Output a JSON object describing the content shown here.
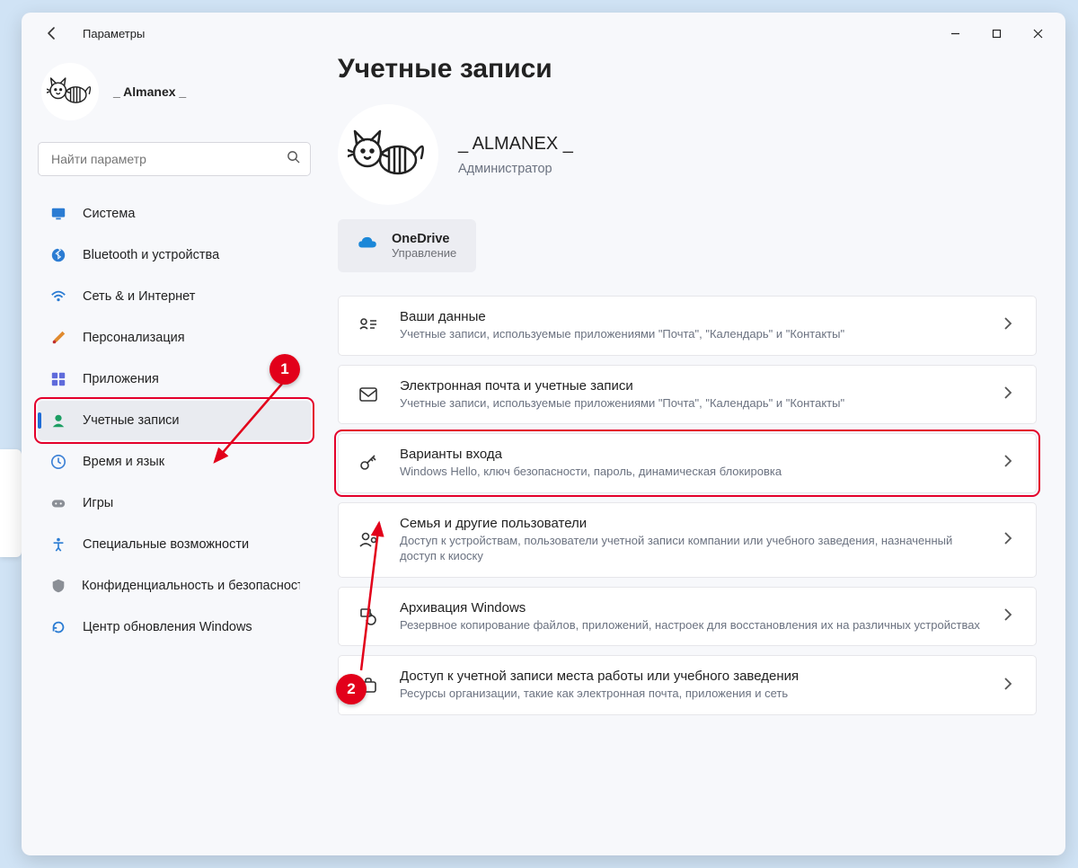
{
  "window": {
    "title": "Параметры"
  },
  "sidebar": {
    "profile_name": "_ Almanex _",
    "search_placeholder": "Найти параметр",
    "items": [
      {
        "id": "system",
        "label": "Система"
      },
      {
        "id": "bluetooth",
        "label": "Bluetooth и устройства"
      },
      {
        "id": "network",
        "label": "Сеть & и Интернет"
      },
      {
        "id": "personalization",
        "label": "Персонализация"
      },
      {
        "id": "apps",
        "label": "Приложения"
      },
      {
        "id": "accounts",
        "label": "Учетные записи"
      },
      {
        "id": "time",
        "label": "Время и язык"
      },
      {
        "id": "gaming",
        "label": "Игры"
      },
      {
        "id": "accessibility",
        "label": "Специальные возможности"
      },
      {
        "id": "privacy",
        "label": "Конфиденциальность и безопасность"
      },
      {
        "id": "update",
        "label": "Центр обновления Windows"
      }
    ]
  },
  "main": {
    "title": "Учетные записи",
    "profile_name": "_ ALMANEX _",
    "profile_role": "Администратор",
    "onedrive": {
      "title": "OneDrive",
      "sub": "Управление"
    },
    "cards": [
      {
        "id": "your-info",
        "title": "Ваши данные",
        "sub": "Учетные записи, используемые приложениями \"Почта\", \"Календарь\" и \"Контакты\""
      },
      {
        "id": "email",
        "title": "Электронная почта и учетные записи",
        "sub": "Учетные записи, используемые приложениями \"Почта\", \"Календарь\" и \"Контакты\""
      },
      {
        "id": "signin",
        "title": "Варианты входа",
        "sub": "Windows Hello, ключ безопасности, пароль, динамическая блокировка"
      },
      {
        "id": "family",
        "title": "Семья и другие пользователи",
        "sub": "Доступ к устройствам, пользователи учетной записи компании или учебного заведения, назначенный доступ к киоску"
      },
      {
        "id": "backup",
        "title": "Архивация Windows",
        "sub": "Резервное копирование файлов, приложений, настроек для восстановления их на различных устройствах"
      },
      {
        "id": "work",
        "title": "Доступ к учетной записи места работы или учебного заведения",
        "sub": "Ресурсы организации, такие как электронная почта, приложения и сеть"
      }
    ]
  },
  "annotations": {
    "b1": "1",
    "b2": "2"
  }
}
